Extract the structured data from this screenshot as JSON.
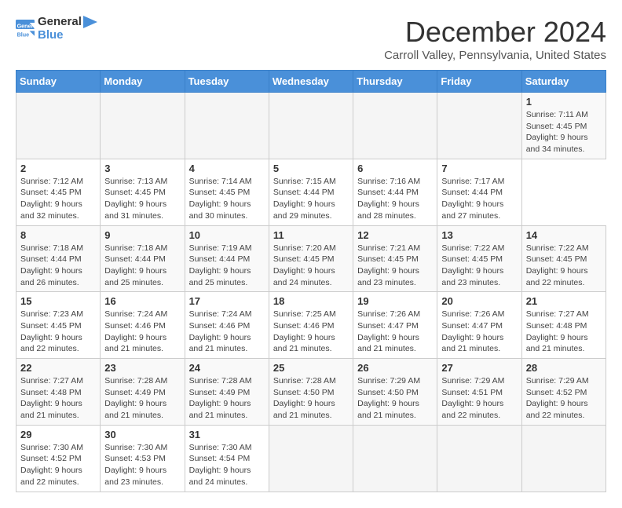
{
  "header": {
    "logo_general": "General",
    "logo_blue": "Blue",
    "month_title": "December 2024",
    "location": "Carroll Valley, Pennsylvania, United States"
  },
  "calendar": {
    "days_of_week": [
      "Sunday",
      "Monday",
      "Tuesday",
      "Wednesday",
      "Thursday",
      "Friday",
      "Saturday"
    ],
    "weeks": [
      [
        null,
        null,
        null,
        null,
        null,
        null,
        {
          "day": "1",
          "sunrise": "Sunrise: 7:11 AM",
          "sunset": "Sunset: 4:45 PM",
          "daylight": "Daylight: 9 hours and 34 minutes."
        }
      ],
      [
        {
          "day": "2",
          "sunrise": "Sunrise: 7:12 AM",
          "sunset": "Sunset: 4:45 PM",
          "daylight": "Daylight: 9 hours and 32 minutes."
        },
        {
          "day": "3",
          "sunrise": "Sunrise: 7:13 AM",
          "sunset": "Sunset: 4:45 PM",
          "daylight": "Daylight: 9 hours and 31 minutes."
        },
        {
          "day": "4",
          "sunrise": "Sunrise: 7:14 AM",
          "sunset": "Sunset: 4:45 PM",
          "daylight": "Daylight: 9 hours and 30 minutes."
        },
        {
          "day": "5",
          "sunrise": "Sunrise: 7:15 AM",
          "sunset": "Sunset: 4:44 PM",
          "daylight": "Daylight: 9 hours and 29 minutes."
        },
        {
          "day": "6",
          "sunrise": "Sunrise: 7:16 AM",
          "sunset": "Sunset: 4:44 PM",
          "daylight": "Daylight: 9 hours and 28 minutes."
        },
        {
          "day": "7",
          "sunrise": "Sunrise: 7:17 AM",
          "sunset": "Sunset: 4:44 PM",
          "daylight": "Daylight: 9 hours and 27 minutes."
        }
      ],
      [
        {
          "day": "8",
          "sunrise": "Sunrise: 7:18 AM",
          "sunset": "Sunset: 4:44 PM",
          "daylight": "Daylight: 9 hours and 26 minutes."
        },
        {
          "day": "9",
          "sunrise": "Sunrise: 7:18 AM",
          "sunset": "Sunset: 4:44 PM",
          "daylight": "Daylight: 9 hours and 25 minutes."
        },
        {
          "day": "10",
          "sunrise": "Sunrise: 7:19 AM",
          "sunset": "Sunset: 4:44 PM",
          "daylight": "Daylight: 9 hours and 25 minutes."
        },
        {
          "day": "11",
          "sunrise": "Sunrise: 7:20 AM",
          "sunset": "Sunset: 4:45 PM",
          "daylight": "Daylight: 9 hours and 24 minutes."
        },
        {
          "day": "12",
          "sunrise": "Sunrise: 7:21 AM",
          "sunset": "Sunset: 4:45 PM",
          "daylight": "Daylight: 9 hours and 23 minutes."
        },
        {
          "day": "13",
          "sunrise": "Sunrise: 7:22 AM",
          "sunset": "Sunset: 4:45 PM",
          "daylight": "Daylight: 9 hours and 23 minutes."
        },
        {
          "day": "14",
          "sunrise": "Sunrise: 7:22 AM",
          "sunset": "Sunset: 4:45 PM",
          "daylight": "Daylight: 9 hours and 22 minutes."
        }
      ],
      [
        {
          "day": "15",
          "sunrise": "Sunrise: 7:23 AM",
          "sunset": "Sunset: 4:45 PM",
          "daylight": "Daylight: 9 hours and 22 minutes."
        },
        {
          "day": "16",
          "sunrise": "Sunrise: 7:24 AM",
          "sunset": "Sunset: 4:46 PM",
          "daylight": "Daylight: 9 hours and 21 minutes."
        },
        {
          "day": "17",
          "sunrise": "Sunrise: 7:24 AM",
          "sunset": "Sunset: 4:46 PM",
          "daylight": "Daylight: 9 hours and 21 minutes."
        },
        {
          "day": "18",
          "sunrise": "Sunrise: 7:25 AM",
          "sunset": "Sunset: 4:46 PM",
          "daylight": "Daylight: 9 hours and 21 minutes."
        },
        {
          "day": "19",
          "sunrise": "Sunrise: 7:26 AM",
          "sunset": "Sunset: 4:47 PM",
          "daylight": "Daylight: 9 hours and 21 minutes."
        },
        {
          "day": "20",
          "sunrise": "Sunrise: 7:26 AM",
          "sunset": "Sunset: 4:47 PM",
          "daylight": "Daylight: 9 hours and 21 minutes."
        },
        {
          "day": "21",
          "sunrise": "Sunrise: 7:27 AM",
          "sunset": "Sunset: 4:48 PM",
          "daylight": "Daylight: 9 hours and 21 minutes."
        }
      ],
      [
        {
          "day": "22",
          "sunrise": "Sunrise: 7:27 AM",
          "sunset": "Sunset: 4:48 PM",
          "daylight": "Daylight: 9 hours and 21 minutes."
        },
        {
          "day": "23",
          "sunrise": "Sunrise: 7:28 AM",
          "sunset": "Sunset: 4:49 PM",
          "daylight": "Daylight: 9 hours and 21 minutes."
        },
        {
          "day": "24",
          "sunrise": "Sunrise: 7:28 AM",
          "sunset": "Sunset: 4:49 PM",
          "daylight": "Daylight: 9 hours and 21 minutes."
        },
        {
          "day": "25",
          "sunrise": "Sunrise: 7:28 AM",
          "sunset": "Sunset: 4:50 PM",
          "daylight": "Daylight: 9 hours and 21 minutes."
        },
        {
          "day": "26",
          "sunrise": "Sunrise: 7:29 AM",
          "sunset": "Sunset: 4:50 PM",
          "daylight": "Daylight: 9 hours and 21 minutes."
        },
        {
          "day": "27",
          "sunrise": "Sunrise: 7:29 AM",
          "sunset": "Sunset: 4:51 PM",
          "daylight": "Daylight: 9 hours and 22 minutes."
        },
        {
          "day": "28",
          "sunrise": "Sunrise: 7:29 AM",
          "sunset": "Sunset: 4:52 PM",
          "daylight": "Daylight: 9 hours and 22 minutes."
        }
      ],
      [
        {
          "day": "29",
          "sunrise": "Sunrise: 7:30 AM",
          "sunset": "Sunset: 4:52 PM",
          "daylight": "Daylight: 9 hours and 22 minutes."
        },
        {
          "day": "30",
          "sunrise": "Sunrise: 7:30 AM",
          "sunset": "Sunset: 4:53 PM",
          "daylight": "Daylight: 9 hours and 23 minutes."
        },
        {
          "day": "31",
          "sunrise": "Sunrise: 7:30 AM",
          "sunset": "Sunset: 4:54 PM",
          "daylight": "Daylight: 9 hours and 24 minutes."
        },
        null,
        null,
        null,
        null
      ]
    ]
  }
}
